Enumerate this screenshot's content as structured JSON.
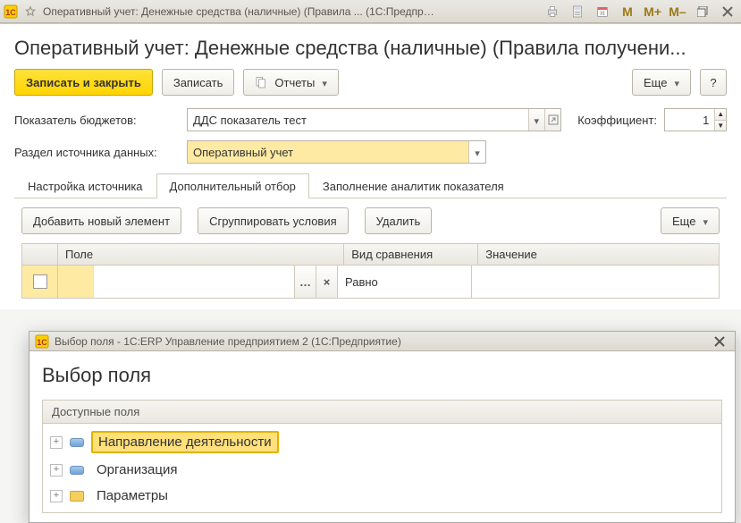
{
  "titlebar": {
    "title": "Оперативный учет: Денежные средства (наличные) (Правила ... (1С:Предприятие)",
    "markers": [
      "M",
      "M+",
      "M–"
    ]
  },
  "page": {
    "title": "Оперативный учет: Денежные средства (наличные) (Правила получени..."
  },
  "toolbar": {
    "save_close_label": "Записать и закрыть",
    "save_label": "Записать",
    "reports_label": "Отчеты",
    "more_label": "Еще",
    "help_label": "?"
  },
  "form": {
    "indicator_label": "Показатель бюджетов:",
    "indicator_value": "ДДС показатель тест",
    "coef_label": "Коэффициент:",
    "coef_value": "1",
    "section_label": "Раздел источника данных:",
    "section_value": "Оперативный учет"
  },
  "tabs": [
    {
      "label": "Настройка источника",
      "active": false
    },
    {
      "label": "Дополнительный отбор",
      "active": true
    },
    {
      "label": "Заполнение аналитик показателя",
      "active": false
    }
  ],
  "subbar": {
    "add_label": "Добавить новый элемент",
    "group_label": "Сгруппировать условия",
    "delete_label": "Удалить",
    "more_label": "Еще"
  },
  "grid": {
    "headers": {
      "field": "Поле",
      "cmp": "Вид сравнения",
      "val": "Значение"
    },
    "row": {
      "field": "",
      "cmp": "Равно",
      "val": ""
    }
  },
  "dialog": {
    "titlebar": "Выбор поля - 1С:ERP Управление предприятием 2 (1С:Предприятие)",
    "title": "Выбор поля",
    "panel_header": "Доступные поля",
    "items": [
      {
        "label": "Направление деятельности",
        "type": "field",
        "selected": true
      },
      {
        "label": "Организация",
        "type": "field",
        "selected": false
      },
      {
        "label": "Параметры",
        "type": "folder",
        "selected": false
      }
    ]
  }
}
